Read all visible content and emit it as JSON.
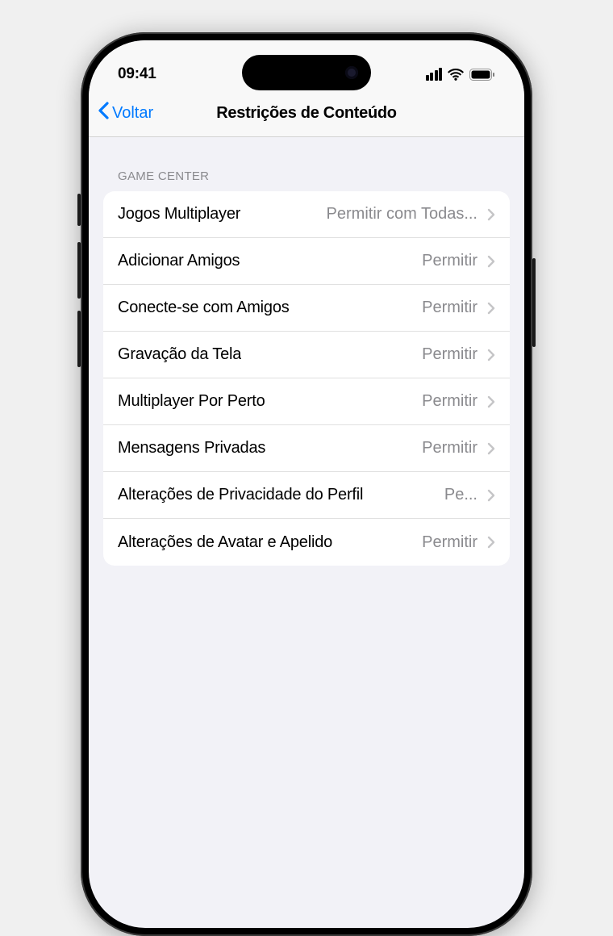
{
  "status": {
    "time": "09:41"
  },
  "nav": {
    "back_label": "Voltar",
    "title": "Restrições de Conteúdo"
  },
  "section": {
    "header": "GAME CENTER",
    "rows": [
      {
        "label": "Jogos Multiplayer",
        "value": "Permitir com Todas..."
      },
      {
        "label": "Adicionar Amigos",
        "value": "Permitir"
      },
      {
        "label": "Conecte-se com Amigos",
        "value": "Permitir"
      },
      {
        "label": "Gravação da Tela",
        "value": "Permitir"
      },
      {
        "label": "Multiplayer Por Perto",
        "value": "Permitir"
      },
      {
        "label": "Mensagens Privadas",
        "value": "Permitir"
      },
      {
        "label": "Alterações de Privacidade do Perfil",
        "value": "Pe..."
      },
      {
        "label": "Alterações de Avatar e Apelido",
        "value": "Permitir"
      }
    ]
  }
}
